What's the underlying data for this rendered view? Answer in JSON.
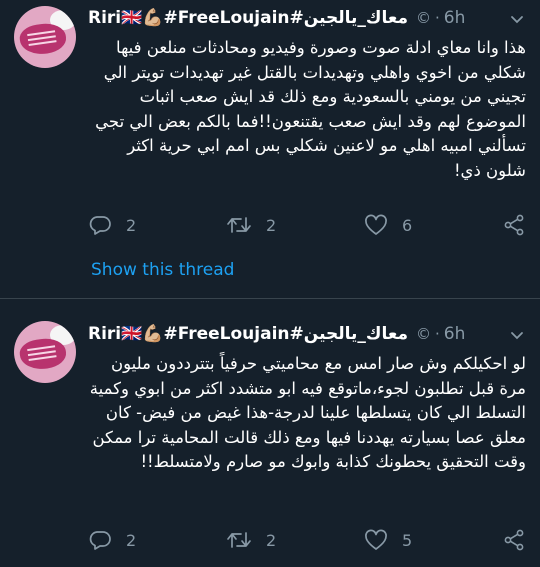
{
  "tweets": [
    {
      "name": "Riri🇬🇧💪🏼#FreeLoujain#معاك_يالجين",
      "handle_icon": "©",
      "time": "6h",
      "text": "هذا وانا معاي ادلة صوت وصورة وفيديو ومحادثات منلعن فيها شكلي من اخوي واهلي وتهديدات بالقتل غير تهديدات تويتر الي تجيني من يومني بالسعودية ومع ذلك قد ايش صعب اثبات الموضوع لهم وقد ايش صعب يقتنعون!!فما بالكم بعض الي تجي تسألني امبيه اهلي مو لاعنين شكلي بس امم ابي حرية اكثر شلون ذي!",
      "replies": "2",
      "retweets": "2",
      "likes": "6",
      "show_thread": "Show this thread"
    },
    {
      "name": "Riri🇬🇧💪🏼#FreeLoujain#معاك_يالجين",
      "handle_icon": "©",
      "time": "6h",
      "text": "لو احكيلكم وش صار امس مع محاميتي حرفياً بتترددون مليون مرة قبل تطلبون لجوء،ماتوقع فيه ابو متشدد اكثر من ابوي وكمية التسلط الي كان يتسلطها علينا لدرجة-هذا غيض من فيض- كان معلق عصا بسيارته يهددنا فيها ومع ذلك قالت المحامية ترا ممكن وقت التحقيق يحطونك كذابة وابوك مو صارم ولامتسلط!!",
      "replies": "2",
      "retweets": "2",
      "likes": "5"
    }
  ],
  "separator": "·",
  "icons": [
    "chevron-down-icon",
    "reply-icon",
    "retweet-icon",
    "like-icon",
    "share-icon"
  ],
  "colors": {
    "background": "#15202b",
    "muted": "#8899a6",
    "link": "#1da1f2",
    "divider": "#38444d"
  }
}
